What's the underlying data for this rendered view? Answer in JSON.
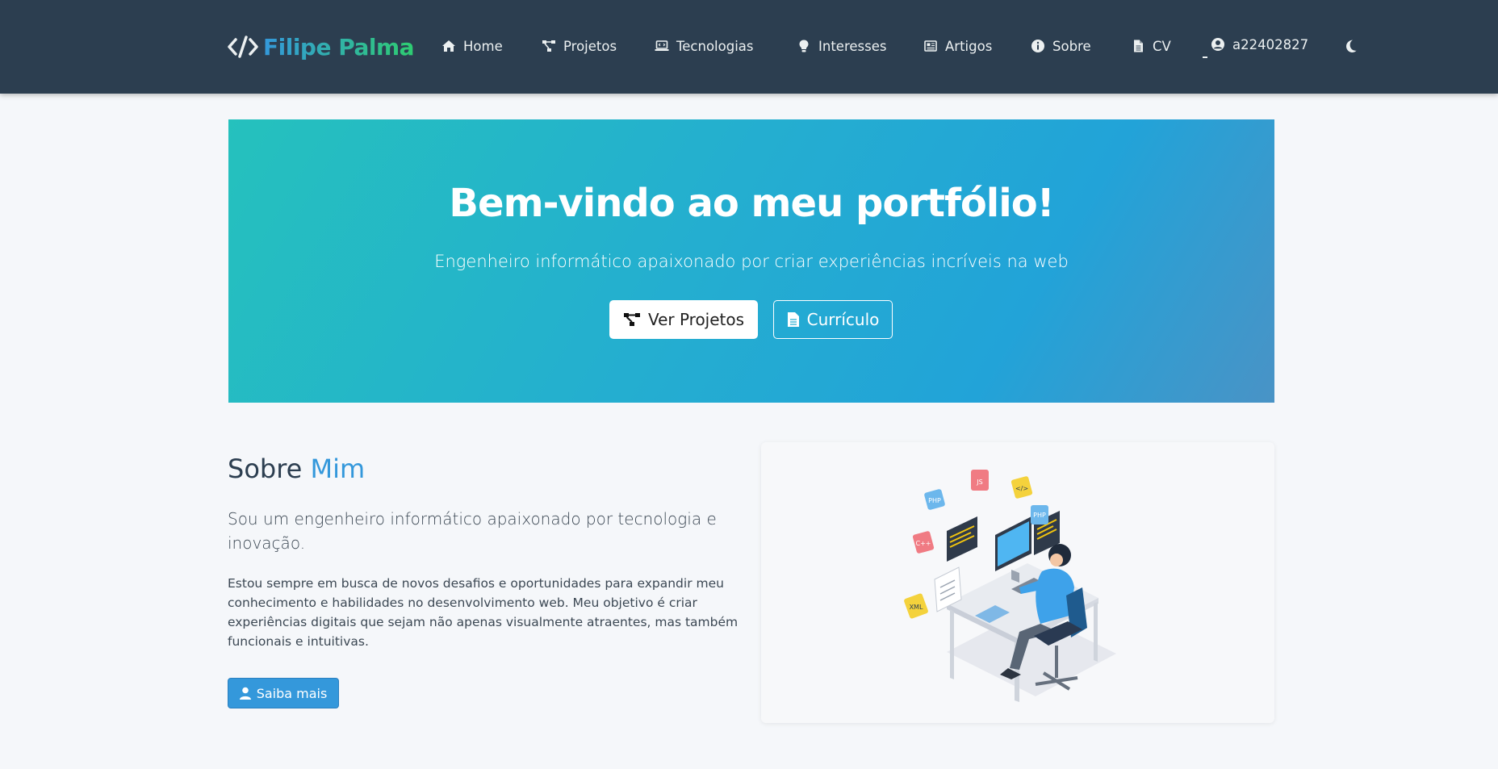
{
  "nav": {
    "brand": "Filipe Palma",
    "items": [
      {
        "label": "Home",
        "icon": "home-icon"
      },
      {
        "label": "Projetos",
        "icon": "project-diagram-icon"
      },
      {
        "label": "Tecnologias",
        "icon": "laptop-code-icon"
      },
      {
        "label": "Interesses",
        "icon": "lightbulb-icon"
      },
      {
        "label": "Artigos",
        "icon": "newspaper-icon"
      },
      {
        "label": "Sobre",
        "icon": "info-circle-icon"
      },
      {
        "label": "CV",
        "icon": "file-icon"
      }
    ],
    "user": "a22402827",
    "theme_icon": "moon-icon"
  },
  "hero": {
    "title": "Bem-vindo ao meu portfólio!",
    "subtitle": "Engenheiro informático apaixonado por criar experiências incríveis na web",
    "btn_projects": "Ver Projetos",
    "btn_cv": "Currículo"
  },
  "about": {
    "title_plain": "Sobre",
    "title_accent": "Mim",
    "lead": "Sou um engenheiro informático apaixonado por tecnologia e inovação.",
    "text": "Estou sempre em busca de novos desafios e oportunidades para expandir meu conhecimento e habilidades no desenvolvimento web. Meu objetivo é criar experiências digitais que sejam não apenas visualmente atraentes, mas também funcionais e intuitivas.",
    "button": "Saiba mais",
    "illustration_tags": [
      "PHP",
      "JS",
      "</>",
      "PHP",
      "C++",
      "XML"
    ]
  },
  "colors": {
    "navbar": "#2c3e50",
    "accent": "#3498db",
    "brand_gradient_end": "#2ecc71",
    "hero_gradient_start": "#25c1bd",
    "hero_gradient_end": "#4993c6"
  }
}
